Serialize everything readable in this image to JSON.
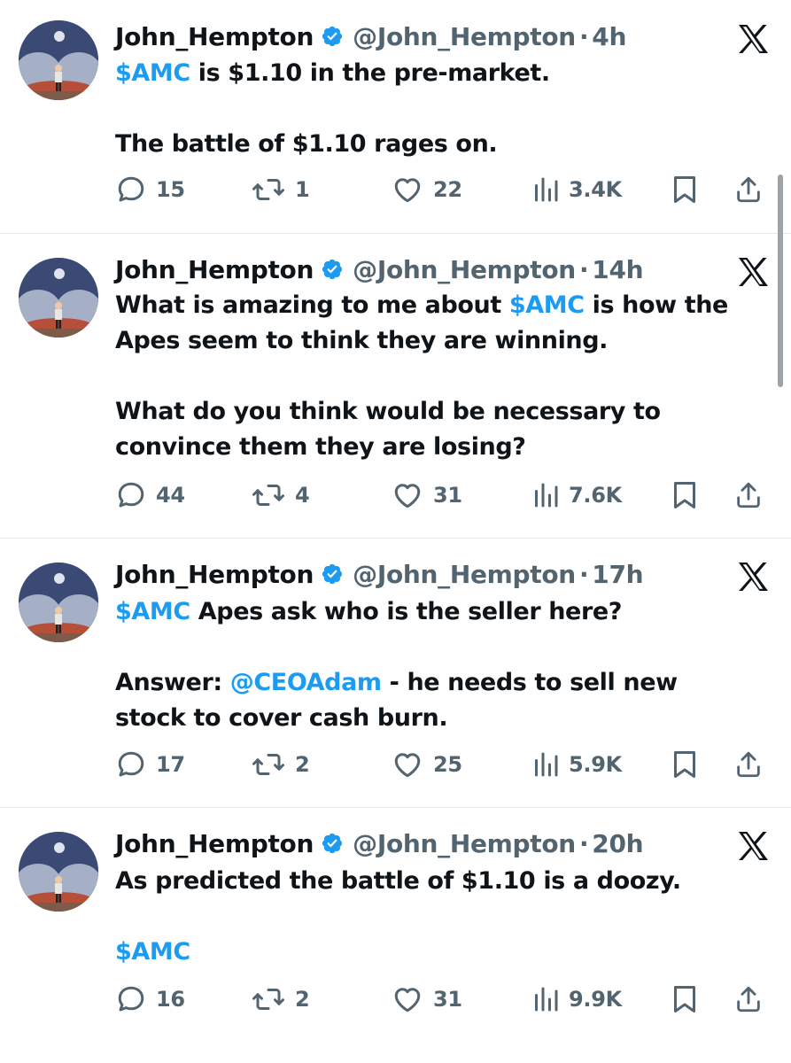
{
  "tweets": [
    {
      "author_name": "John_Hempton",
      "handle": "@John_Hempton",
      "separator": "·",
      "time": "4h",
      "text_lines": [
        [
          {
            "t": "$AMC",
            "link": true
          },
          {
            "t": " is $1.10 in the pre-market.",
            "link": false
          }
        ],
        [],
        [
          {
            "t": "The battle of $1.10 rages on.",
            "link": false
          }
        ]
      ],
      "replies": "15",
      "reposts": "1",
      "likes": "22",
      "views": "3.4K"
    },
    {
      "author_name": "John_Hempton",
      "handle": "@John_Hempton",
      "separator": "·",
      "time": "14h",
      "text_lines": [
        [
          {
            "t": "What is amazing to me about ",
            "link": false
          },
          {
            "t": "$AMC",
            "link": true
          },
          {
            "t": " is how the",
            "link": false
          }
        ],
        [
          {
            "t": "Apes seem to think they are winning.",
            "link": false
          }
        ],
        [],
        [
          {
            "t": "What do you think would be necessary to",
            "link": false
          }
        ],
        [
          {
            "t": "convince them they are losing?",
            "link": false
          }
        ]
      ],
      "replies": "44",
      "reposts": "4",
      "likes": "31",
      "views": "7.6K"
    },
    {
      "author_name": "John_Hempton",
      "handle": "@John_Hempton",
      "separator": "·",
      "time": "17h",
      "text_lines": [
        [
          {
            "t": "$AMC",
            "link": true
          },
          {
            "t": " Apes ask who is the seller here?",
            "link": false
          }
        ],
        [],
        [
          {
            "t": "Answer: ",
            "link": false
          },
          {
            "t": "@CEOAdam",
            "link": true
          },
          {
            "t": " - he needs to sell new",
            "link": false
          }
        ],
        [
          {
            "t": "stock to cover cash burn.",
            "link": false
          }
        ]
      ],
      "replies": "17",
      "reposts": "2",
      "likes": "25",
      "views": "5.9K"
    },
    {
      "author_name": "John_Hempton",
      "handle": "@John_Hempton",
      "separator": "·",
      "time": "20h",
      "text_lines": [
        [
          {
            "t": "As predicted the battle of $1.10 is a doozy.",
            "link": false
          }
        ],
        [],
        [
          {
            "t": "$AMC",
            "link": true
          }
        ]
      ],
      "replies": "16",
      "reposts": "2",
      "likes": "31",
      "views": "9.9K"
    }
  ],
  "icons": {
    "verified": "verified-badge-icon",
    "platform": "x-logo-icon",
    "reply": "reply-icon",
    "repost": "repost-icon",
    "like": "like-icon",
    "views": "views-icon",
    "bookmark": "bookmark-icon",
    "share": "share-icon"
  },
  "colors": {
    "link": "#1d9bf0",
    "verified": "#1d9bf0",
    "secondary_text": "#536471",
    "primary_text": "#0f1419"
  }
}
